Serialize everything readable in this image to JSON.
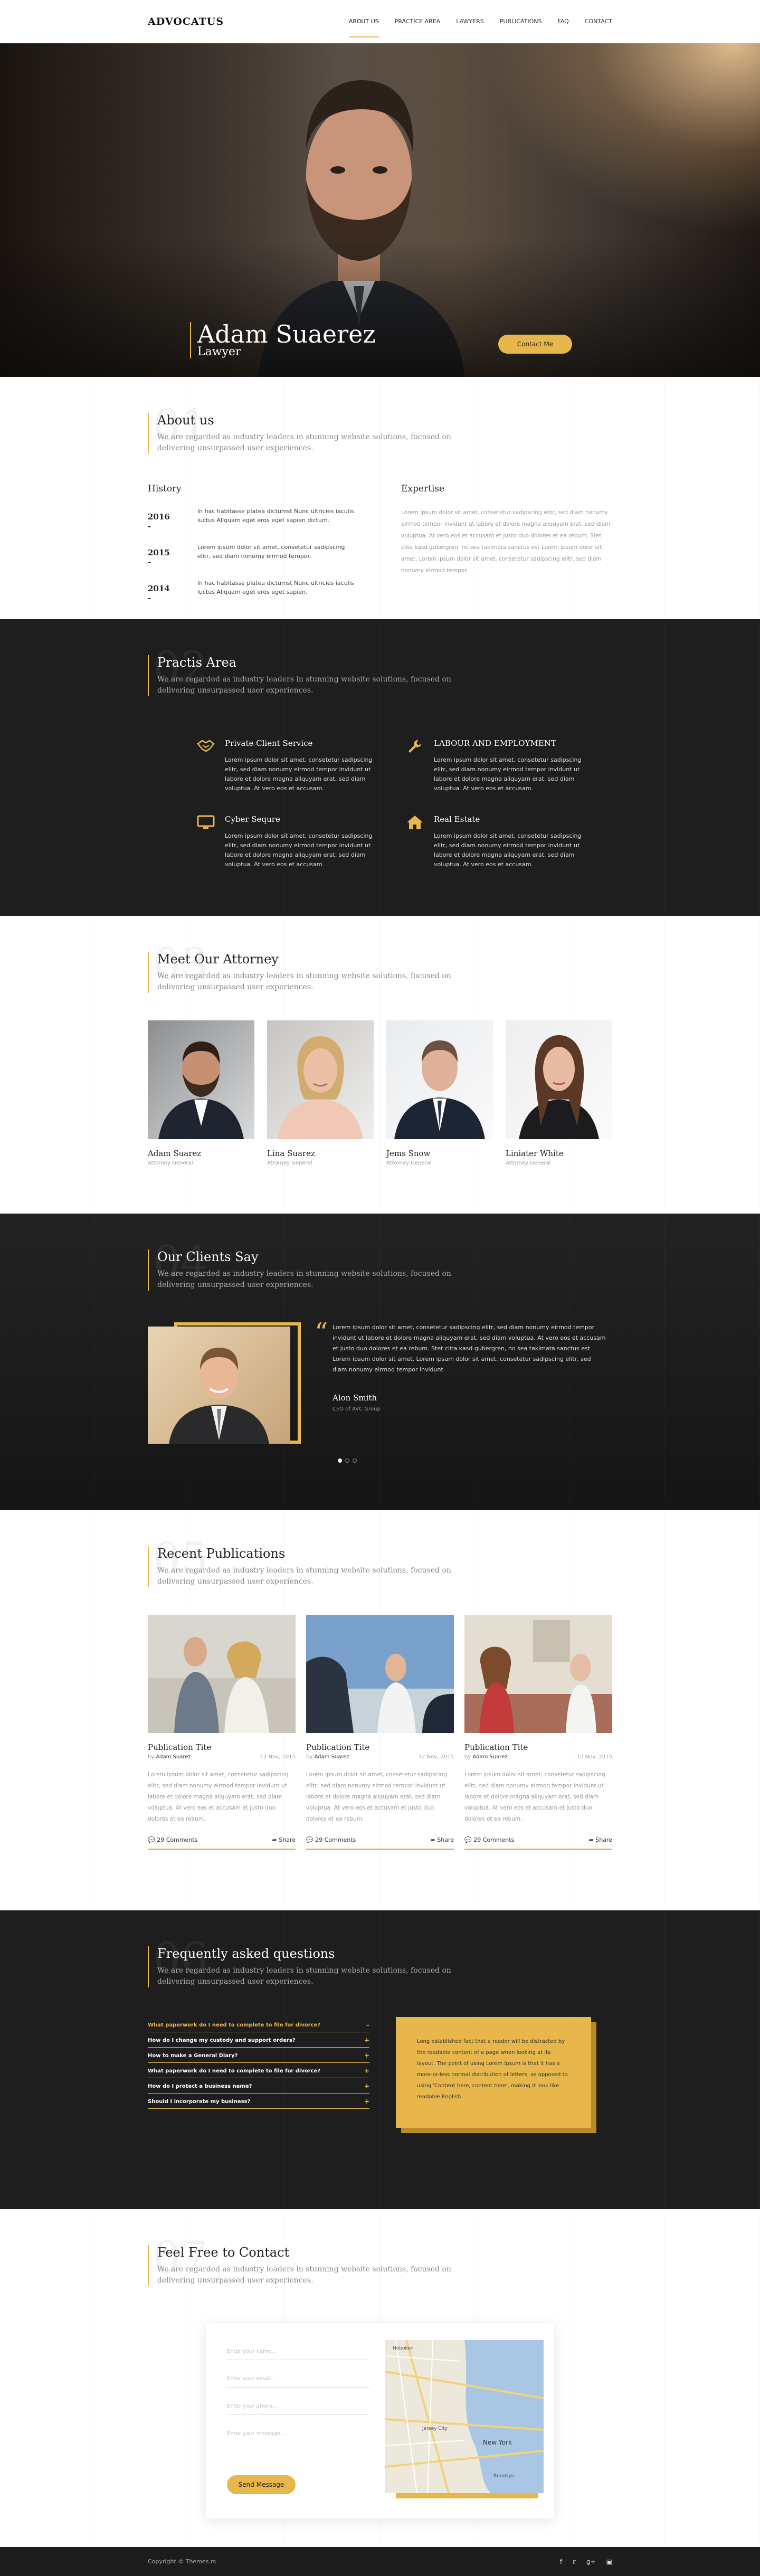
{
  "header": {
    "logo": "ADVOCATUS",
    "nav": [
      "ABOUT US",
      "PRACTICE AREA",
      "LAWYERS",
      "PUBLICATIONS",
      "FAQ",
      "CONTACT"
    ]
  },
  "hero": {
    "name": "Adam Suaerez",
    "role": "Lawyer",
    "button": "Contact Me"
  },
  "about": {
    "num": "01",
    "title": "About us",
    "subtitle": "We are regarded as industry leaders in stunning website solutions, focused on delivering unsurpassed user experiences.",
    "history_title": "History",
    "history": [
      {
        "year": "2016 -",
        "text": "In hac habitasse platea dictumst Nunc ultricies iaculis luctus Aliquam eget eros eget sapien dictum."
      },
      {
        "year": "2015 -",
        "text": "Lorem ipsum dolor sit amet, consetetur sadipscing elitr, sed diam nonumy eirmod tempor."
      },
      {
        "year": "2014 -",
        "text": "In hac habitasse platea dictumst Nunc ultricies iaculis luctus Aliquam eget eros eget sapien."
      }
    ],
    "expertise_title": "Expertise",
    "expertise_text": "Lorem ipsum dolor sit amet, consetetur sadipscing elitr, sed diam nonumy eirmod tempor invidunt ut labore et dolore magna aliquyam erat, sed diam voluptua. At vero eos et accusam et justo duo dolores et ea rebum. Stet clita kasd gubergren, no sea takimata sanctus est Lorem ipsum dolor sit amet. Lorem ipsum dolor sit amet, consetetur sadipscing elitr, sed diam nonumy eirmod tempor."
  },
  "practice": {
    "num": "02",
    "title": "Practis Area",
    "subtitle": "We are regarded as industry leaders in stunning website solutions, focused on delivering unsurpassed user experiences.",
    "services": [
      {
        "title": "Private Client Service",
        "icon": "handshake-icon",
        "text": "Lorem ipsum dolor sit amet, consetetur sadipscing elitr, sed diam nonumy eirmod tempor invidunt ut labore et dolore magna aliquyam erat, sed diam voluptua. At vero eos et accusam."
      },
      {
        "title": "LABOUR AND EMPLOYMENT",
        "icon": "wrench-icon",
        "text": "Lorem ipsum dolor sit amet, consetetur sadipscing elitr, sed diam nonumy eirmod tempor invidunt ut labore et dolore magna aliquyam erat, sed diam voluptua. At vero eos et accusam."
      },
      {
        "title": "Cyber Sequre",
        "icon": "monitor-icon",
        "text": "Lorem ipsum dolor sit amet, consetetur sadipscing elitr, sed diam nonumy eirmod tempor invidunt ut labore et dolore magna aliquyam erat, sed diam voluptua. At vero eos et accusam."
      },
      {
        "title": "Real Estate",
        "icon": "home-icon",
        "text": "Lorem ipsum dolor sit amet, consetetur sadipscing elitr, sed diam nonumy eirmod tempor invidunt ut labore et dolore magna aliquyam erat, sed diam voluptua. At vero eos et accusam."
      }
    ]
  },
  "attorneys": {
    "num": "03",
    "title": "Meet Our Attorney",
    "subtitle": "We are regarded as industry leaders in stunning website solutions, focused on delivering unsurpassed user experiences.",
    "members": [
      {
        "name": "Adam Suarez",
        "role": "Attorney General"
      },
      {
        "name": "Lina Suarez",
        "role": "Attorney General"
      },
      {
        "name": "Jems Snow",
        "role": "Attorney General"
      },
      {
        "name": "Liniater White",
        "role": "Attorney General"
      }
    ]
  },
  "clients": {
    "num": "04",
    "title": "Our Clients Say",
    "subtitle": "We are regarded as industry leaders in stunning website solutions, focused on delivering unsurpassed user experiences.",
    "quote": "Lorem ipsum dolor sit amet, consetetur sadipscing elitr, sed diam nonumy eirmod tempor invidunt ut labore et dolore magna aliquyam erat, sed diam voluptua. At vero eos et accusam et justo duo dolores et ea rebum. Stet clita kasd gubergren, no sea takimata sanctus est Lorem ipsum dolor sit amet. Lorem ipsum dolor sit amet, consetetur sadipscing elitr, sed diam nonumy eirmod tempor invidunt.",
    "author": "Alon Smith",
    "company": "CEO of AVC Group"
  },
  "publications": {
    "num": "05",
    "title": "Recent Publications",
    "subtitle": "We are regarded as industry leaders in stunning website solutions, focused on delivering unsurpassed user experiences.",
    "by_label": "by",
    "items": [
      {
        "title": "Publication Tite",
        "author": "Adam Suarez",
        "date": "12 Nov, 2015",
        "text": "Lorem ipsum dolor sit amet, consetetur sadipscing elitr, sed diam nonumy eirmod tempor invidunt ut labore et dolore magna aliquyam erat, sed diam voluptua. At vero eos et accusam et justo duo dolores et ea rebum.",
        "comments": "29 Comments",
        "share": "Share"
      },
      {
        "title": "Publication Tite",
        "author": "Adam Suarez",
        "date": "12 Nov, 2015",
        "text": "Lorem ipsum dolor sit amet, consetetur sadipscing elitr, sed diam nonumy eirmod tempor invidunt ut labore et dolore magna aliquyam erat, sed diam voluptua. At vero eos et accusam et justo duo dolores et ea rebum.",
        "comments": "29 Comments",
        "share": "Share"
      },
      {
        "title": "Publication Tite",
        "author": "Adam Suarez",
        "date": "12 Nov, 2015",
        "text": "Lorem ipsum dolor sit amet, consetetur sadipscing elitr, sed diam nonumy eirmod tempor invidunt ut labore et dolore magna aliquyam erat, sed diam voluptua. At vero eos et accusam et justo duo dolores et ea rebum.",
        "comments": "29 Comments",
        "share": "Share"
      }
    ]
  },
  "faq": {
    "num": "06",
    "title": "Frequently asked questions",
    "subtitle": "We are regarded as industry leaders in stunning website solutions, focused on delivering unsurpassed user experiences.",
    "questions": [
      "What paperwork do I need to complete to file for divorce?",
      "How do I change my custody and support orders?",
      "How to make a General Diary?",
      "What paperwork do I need to complete to file for divorce?",
      "How do I protect a business name?",
      "Should I incorporate my business?"
    ],
    "answer": "Long established fact that a reader will be distracted by the readable content of a page when looking at its layout. The point of using Lorem Ipsum is that it has a more-or-less normal distribution of letters, as opposed to using 'Content here, content here', making it look like readable English."
  },
  "contact": {
    "num": "07",
    "title": "Feel Free to Contact",
    "subtitle": "We are regarded as industry leaders in stunning website solutions, focused on delivering unsurpassed user experiences.",
    "name_placeholder": "Enter your name...",
    "email_placeholder": "Enter your email...",
    "phone_placeholder": "Enter your phone...",
    "message_placeholder": "Enter your message...",
    "button": "Send Message",
    "map_labels": [
      "Hoboken",
      "New York",
      "Jersey City",
      "Brooklyn"
    ]
  },
  "footer": {
    "copyright": "Copyright © Themes.rs",
    "social": [
      "facebook-icon",
      "twitter-icon",
      "google-plus-icon",
      "instagram-icon"
    ]
  },
  "colors": {
    "accent": "#e8b74c",
    "dark": "#1e1e1e"
  }
}
